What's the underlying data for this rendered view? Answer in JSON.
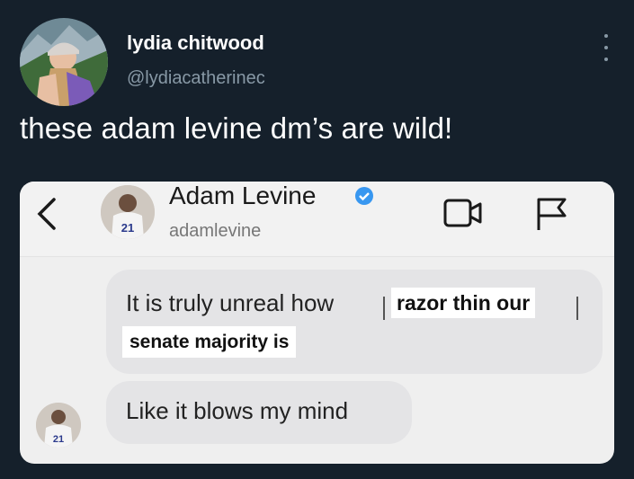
{
  "tweet": {
    "author_name": "lydia chitwood",
    "author_handle": "@lydiacatherinec",
    "text": "these adam levine dm’s are wild!"
  },
  "icons": {
    "more": "more-vertical-icon",
    "back": "chevron-left-icon",
    "verified": "verified-badge-icon",
    "video": "video-call-icon",
    "flag": "flag-icon"
  },
  "dm": {
    "contact_name": "Adam Levine",
    "contact_handle": "adamlevine",
    "jersey_number": "21",
    "messages": [
      {
        "lead": "It is truly unreal how",
        "redacted_line_1": "razor thin our",
        "redacted_line_2": "senate majority is"
      },
      {
        "text": "Like it blows my mind"
      }
    ]
  },
  "colors": {
    "background": "#15202b",
    "handle_gray": "#8899a6",
    "verified_blue": "#3897f0",
    "bubble_gray": "#e4e4e6"
  }
}
